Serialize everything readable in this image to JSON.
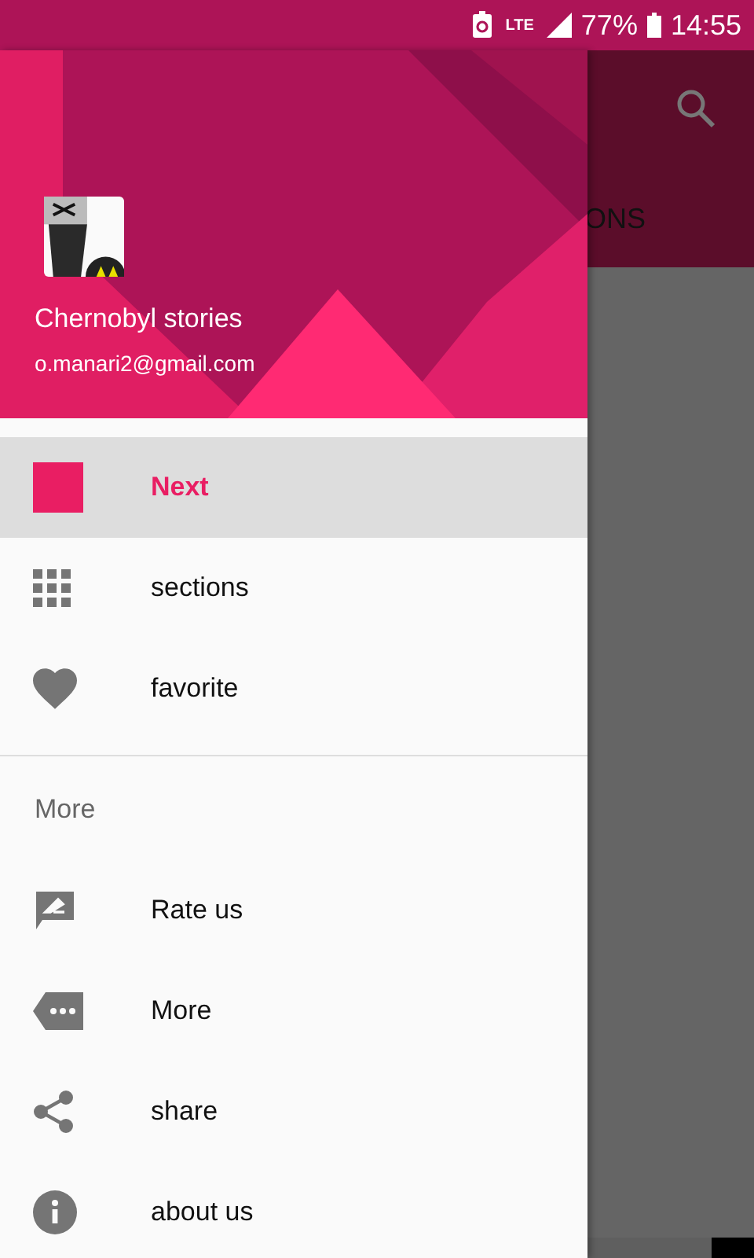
{
  "status_bar": {
    "network": "LTE",
    "battery": "77%",
    "time": "14:55"
  },
  "app_bar": {
    "tab_text": "ONS"
  },
  "drawer": {
    "header": {
      "title": "Chernobyl stories",
      "email": "o.manari2@gmail.com"
    },
    "items": [
      {
        "kind": "square",
        "label": "Next",
        "selected": true
      },
      {
        "kind": "grid",
        "label": "sections",
        "selected": false
      },
      {
        "kind": "heart",
        "label": "favorite",
        "selected": false
      }
    ],
    "more_section": {
      "title": "More",
      "items": [
        {
          "kind": "rate",
          "label": "Rate us",
          "selected": false
        },
        {
          "kind": "more",
          "label": "More",
          "selected": false
        },
        {
          "kind": "share",
          "label": "share",
          "selected": false
        },
        {
          "kind": "info",
          "label": "about us",
          "selected": false
        }
      ]
    }
  }
}
